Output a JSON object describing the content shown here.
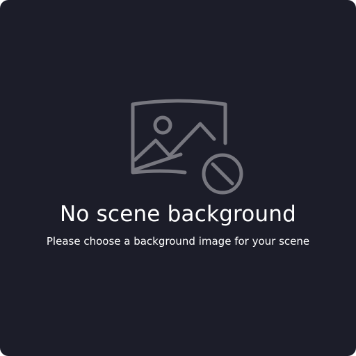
{
  "empty_state": {
    "icon": "image-off-icon",
    "title": "No scene background",
    "message": "Please choose a background image for your scene"
  },
  "colors": {
    "panel_background": "#1c1d29",
    "icon": "#77777f",
    "text": "#ffffff"
  }
}
